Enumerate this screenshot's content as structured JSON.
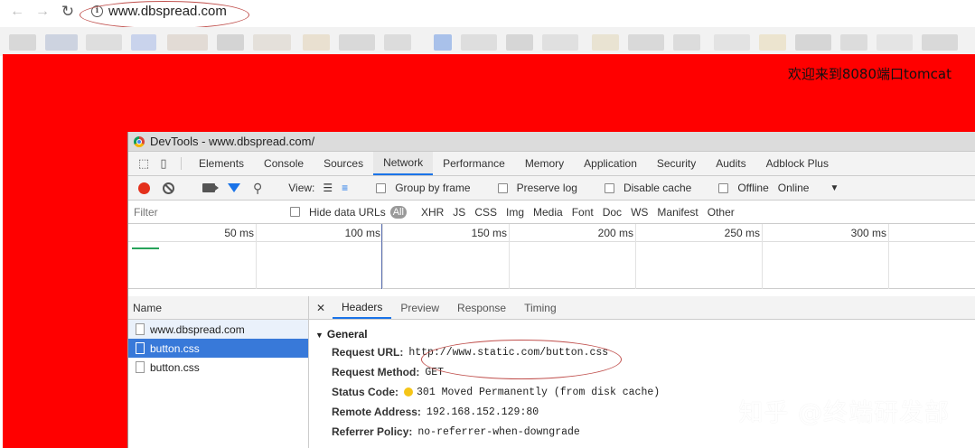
{
  "browser": {
    "url": "www.dbspread.com"
  },
  "page": {
    "welcome_text": "欢迎来到8080端口tomcat"
  },
  "devtools": {
    "title": "DevTools - www.dbspread.com/",
    "tabs": [
      {
        "label": "Elements"
      },
      {
        "label": "Console"
      },
      {
        "label": "Sources"
      },
      {
        "label": "Network"
      },
      {
        "label": "Performance"
      },
      {
        "label": "Memory"
      },
      {
        "label": "Application"
      },
      {
        "label": "Security"
      },
      {
        "label": "Audits"
      },
      {
        "label": "Adblock Plus"
      }
    ],
    "active_tab": "Network",
    "toolbar": {
      "view_label": "View:",
      "group_by_frame": "Group by frame",
      "preserve_log": "Preserve log",
      "disable_cache": "Disable cache",
      "offline": "Offline",
      "throttle": "Online"
    },
    "filter": {
      "placeholder": "Filter",
      "hide_data_urls": "Hide data URLs",
      "types": [
        "All",
        "XHR",
        "JS",
        "CSS",
        "Img",
        "Media",
        "Font",
        "Doc",
        "WS",
        "Manifest",
        "Other"
      ]
    },
    "timeline": {
      "ticks": [
        "50 ms",
        "100 ms",
        "150 ms",
        "200 ms",
        "250 ms",
        "300 ms"
      ]
    },
    "requests": {
      "header": "Name",
      "rows": [
        {
          "name": "www.dbspread.com"
        },
        {
          "name": "button.css"
        },
        {
          "name": "button.css"
        }
      ],
      "selected_index": 1
    },
    "detail": {
      "tabs": [
        "Headers",
        "Preview",
        "Response",
        "Timing"
      ],
      "active_tab": "Headers",
      "section": "General",
      "fields": [
        {
          "key": "Request URL:",
          "value": "http://www.static.com/button.css"
        },
        {
          "key": "Request Method:",
          "value": "GET"
        },
        {
          "key": "Status Code:",
          "value": "301 Moved Permanently (from disk cache)"
        },
        {
          "key": "Remote Address:",
          "value": "192.168.152.129:80"
        },
        {
          "key": "Referrer Policy:",
          "value": "no-referrer-when-downgrade"
        }
      ]
    }
  },
  "watermark": "知乎 @终端研发部",
  "colors": {
    "page_bg": "#ff0000",
    "accent": "#1a73e8",
    "selection": "#3879d9",
    "annotation": "#c0504d"
  }
}
